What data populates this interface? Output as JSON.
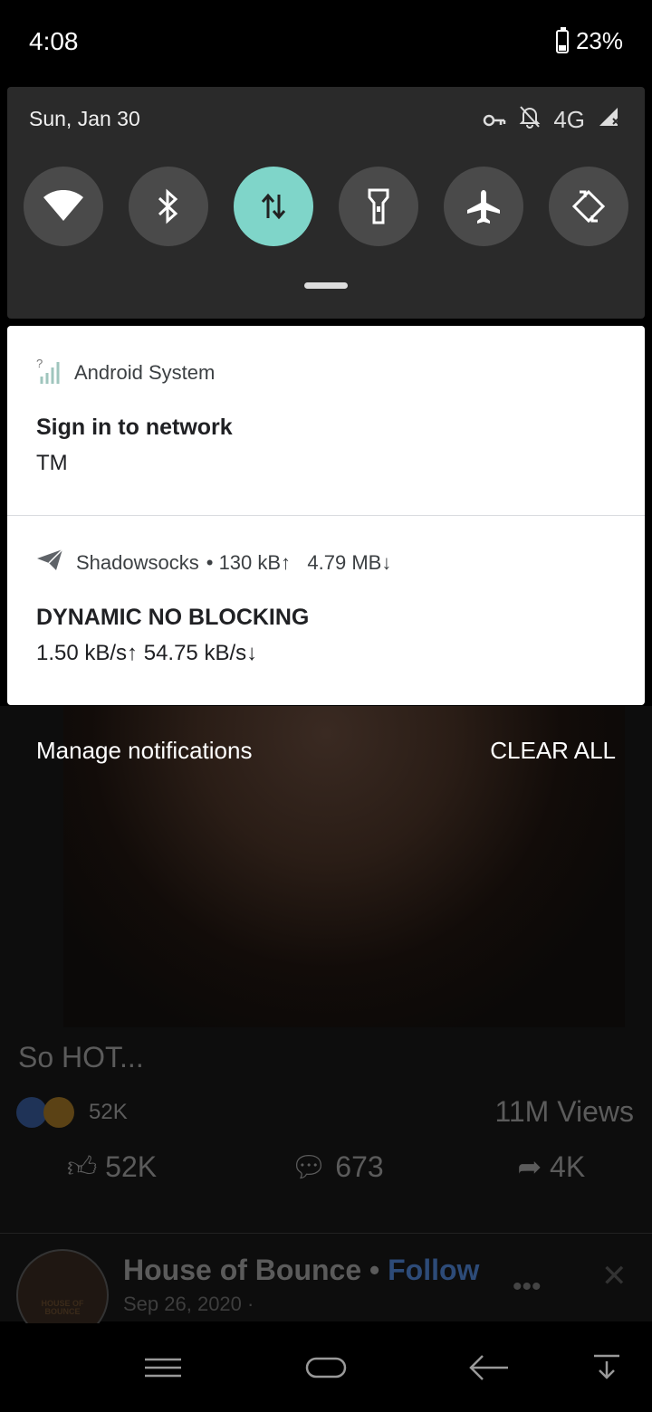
{
  "status": {
    "time": "4:08",
    "battery": "23%"
  },
  "quick_settings": {
    "date": "Sun, Jan 30",
    "network_label": "4G",
    "tiles": [
      {
        "name": "wifi",
        "active": false
      },
      {
        "name": "bluetooth",
        "active": false
      },
      {
        "name": "mobile-data",
        "active": true
      },
      {
        "name": "flashlight",
        "active": false
      },
      {
        "name": "airplane-mode",
        "active": false
      },
      {
        "name": "auto-rotate",
        "active": false
      }
    ]
  },
  "notifications": [
    {
      "app": "Android System",
      "title": "Sign in to network",
      "text": "TM"
    },
    {
      "app": "Shadowsocks",
      "meta": "• 130 kB↑   4.79 MB↓",
      "title": "DYNAMIC NO BLOCKING",
      "text": "1.50 kB/s↑ 54.75 kB/s↓"
    }
  ],
  "actions": {
    "manage": "Manage notifications",
    "clear": "CLEAR ALL"
  },
  "background_post": {
    "caption": "So HOT...",
    "reaction_count": "52K",
    "views": "11M Views",
    "like_count": "52K",
    "comment_count": "673",
    "share_count": "4K",
    "page_name": "House of Bounce",
    "separator": "•",
    "follow": "Follow",
    "date": "Sep 26, 2020 ·",
    "logo_text": "HOUSE OF BOUNCE"
  },
  "colors": {
    "accent_tile": "#7fd5c9",
    "panel": "#2a2a2a"
  }
}
